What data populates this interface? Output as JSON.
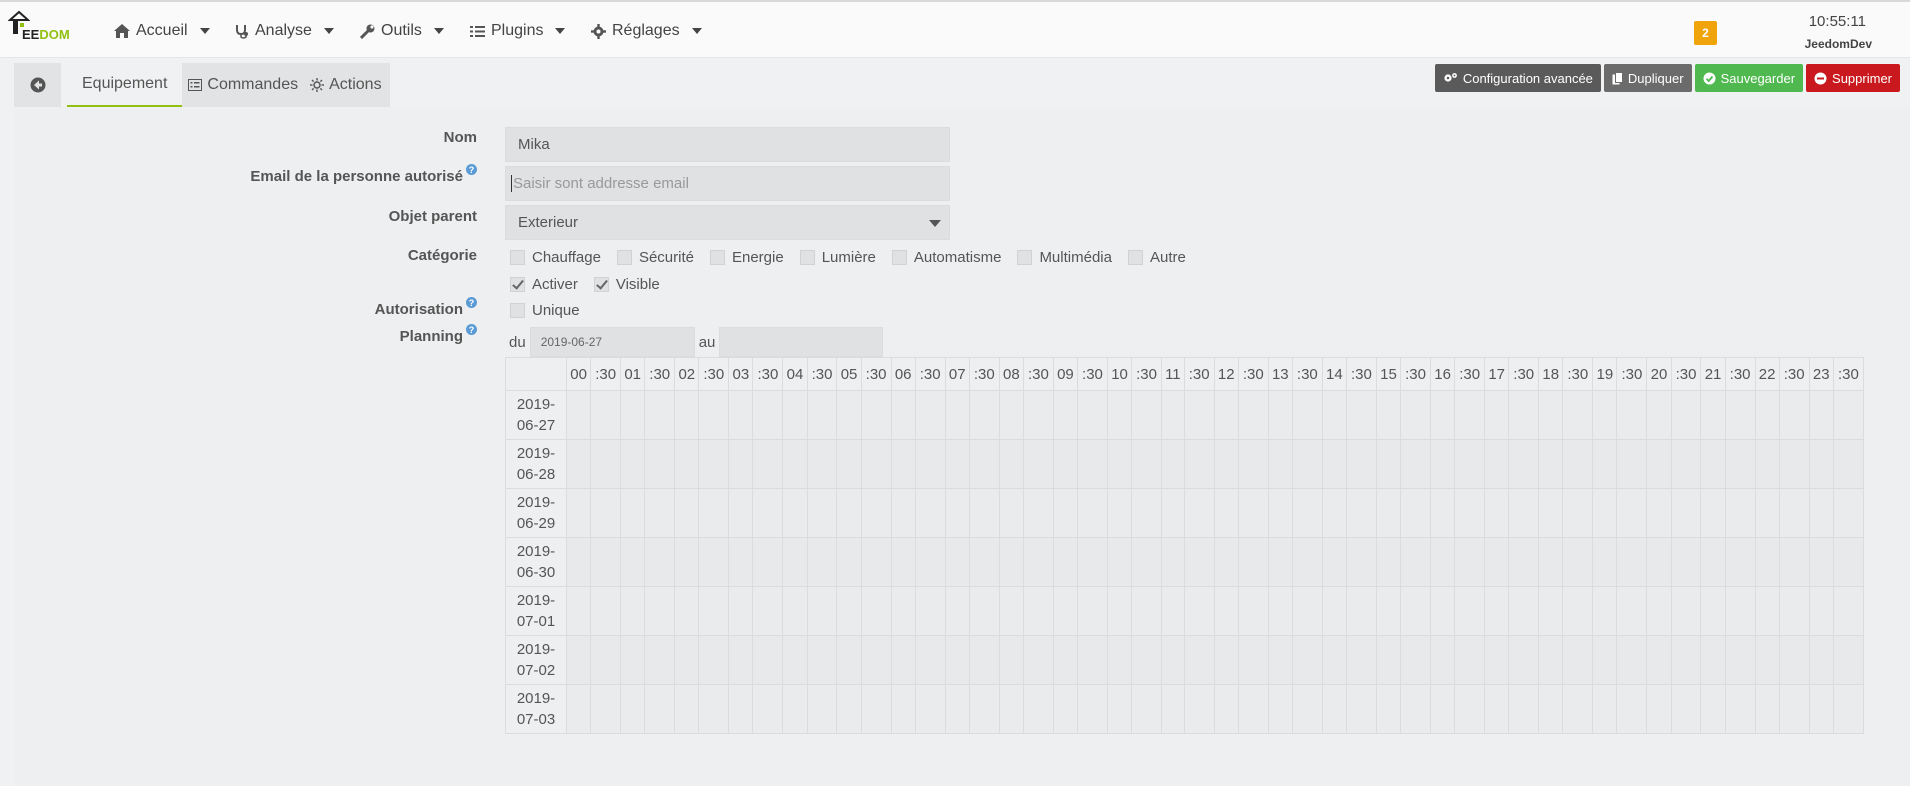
{
  "brand": {
    "logo_text_a": "EE",
    "logo_text_b": "DOM"
  },
  "nav": {
    "items": [
      {
        "label": "Accueil",
        "icon": "home-icon"
      },
      {
        "label": "Analyse",
        "icon": "stethoscope-icon"
      },
      {
        "label": "Outils",
        "icon": "wrench-icon"
      },
      {
        "label": "Plugins",
        "icon": "tasks-icon"
      },
      {
        "label": "Réglages",
        "icon": "gear-icon"
      }
    ],
    "notification_count": "2",
    "time": "10:55:11",
    "user": "JeedomDev"
  },
  "tabs": {
    "equipement": "Equipement",
    "commandes": "Commandes",
    "actions": "Actions"
  },
  "actions": {
    "config": "Configuration avancée",
    "duplicate": "Dupliquer",
    "save": "Sauvegarder",
    "delete": "Supprimer",
    "colors": {
      "gray": "#5a5a5a",
      "green": "#4fb84f",
      "red": "#c9191e",
      "accent": "#92c012",
      "badge": "#f0a30a"
    }
  },
  "form": {
    "nom_label": "Nom",
    "nom_value": "Mika",
    "email_label": "Email de la personne autorisé",
    "email_placeholder": "Saisir sont addresse email",
    "parent_label": "Objet parent",
    "parent_value": "Exterieur",
    "categorie_label": "Catégorie",
    "categories": [
      {
        "label": "Chauffage",
        "checked": false
      },
      {
        "label": "Sécurité",
        "checked": false
      },
      {
        "label": "Energie",
        "checked": false
      },
      {
        "label": "Lumière",
        "checked": false
      },
      {
        "label": "Automatisme",
        "checked": false
      },
      {
        "label": "Multimédia",
        "checked": false
      },
      {
        "label": "Autre",
        "checked": false
      }
    ],
    "activer": "Activer",
    "visible": "Visible",
    "autorisation_label": "Autorisation",
    "unique": "Unique",
    "planning_label": "Planning",
    "du": "du",
    "du_value": "2019-06-27",
    "au": "au",
    "au_value": ""
  },
  "planning": {
    "hours": [
      "00",
      ":30",
      "01",
      ":30",
      "02",
      ":30",
      "03",
      ":30",
      "04",
      ":30",
      "05",
      ":30",
      "06",
      ":30",
      "07",
      ":30",
      "08",
      ":30",
      "09",
      ":30",
      "10",
      ":30",
      "11",
      ":30",
      "12",
      ":30",
      "13",
      ":30",
      "14",
      ":30",
      "15",
      ":30",
      "16",
      ":30",
      "17",
      ":30",
      "18",
      ":30",
      "19",
      ":30",
      "20",
      ":30",
      "21",
      ":30",
      "22",
      ":30",
      "23",
      ":30"
    ],
    "dates": [
      {
        "line1": "2019-",
        "line2": "06-27"
      },
      {
        "line1": "2019-",
        "line2": "06-28"
      },
      {
        "line1": "2019-",
        "line2": "06-29"
      },
      {
        "line1": "2019-",
        "line2": "06-30"
      },
      {
        "line1": "2019-",
        "line2": "07-01"
      },
      {
        "line1": "2019-",
        "line2": "07-02"
      },
      {
        "line1": "2019-",
        "line2": "07-03"
      }
    ]
  }
}
